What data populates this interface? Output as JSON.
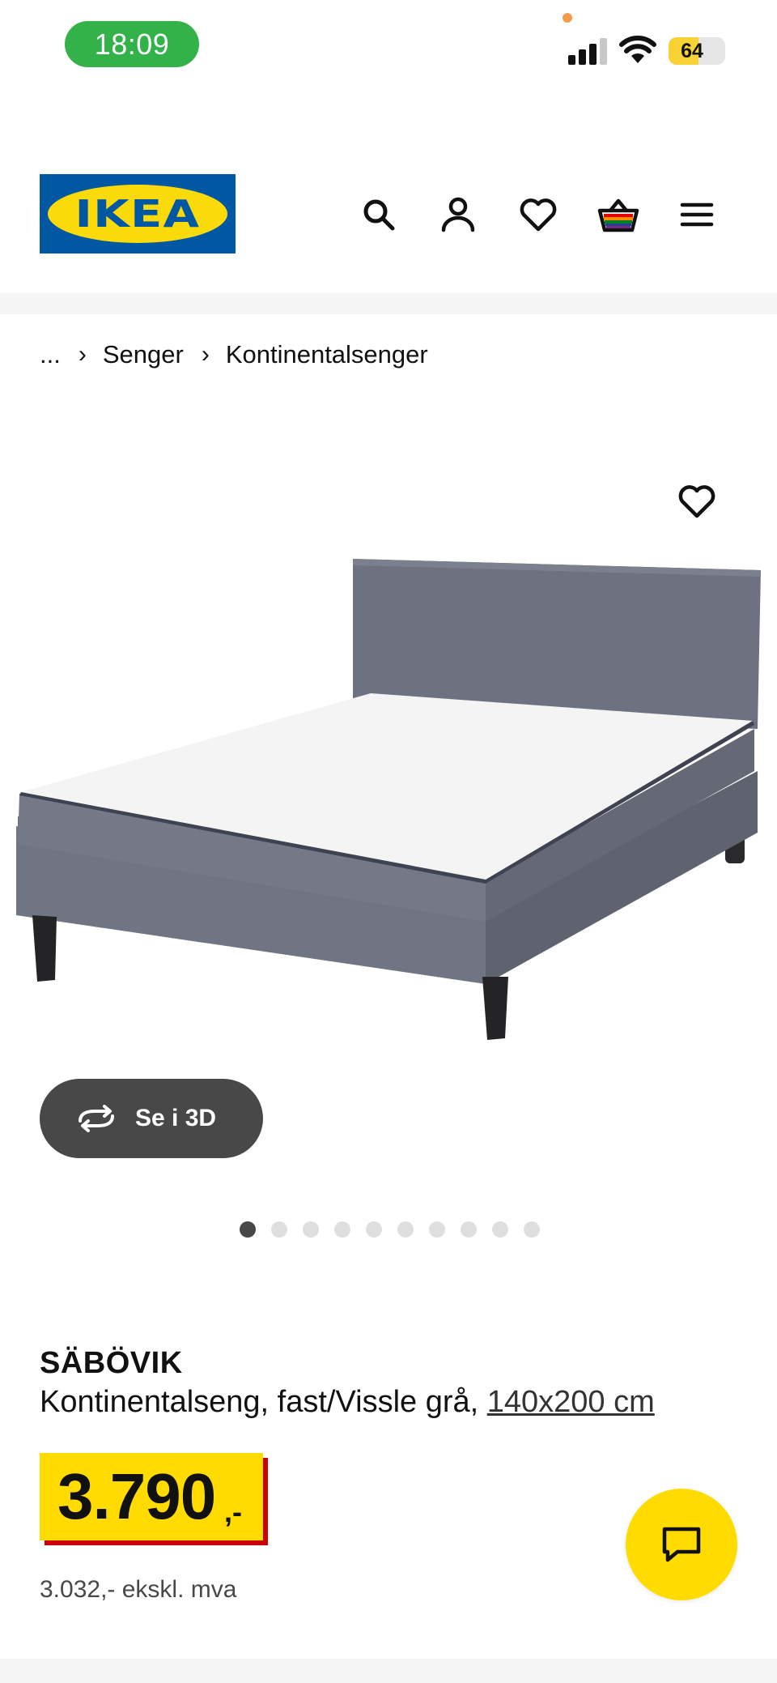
{
  "status_bar": {
    "time": "18:09",
    "battery": "64",
    "battery_level": 0.64
  },
  "header": {
    "logo_text": "IKEA",
    "icons": [
      "search-icon",
      "account-icon",
      "favourites-icon",
      "basket-icon",
      "menu-icon"
    ]
  },
  "breadcrumb": {
    "ellipsis": "...",
    "items": [
      "Senger",
      "Kontinentalsenger"
    ]
  },
  "gallery": {
    "view_3d_label": "Se i 3D",
    "image_count": 10,
    "active_index": 0
  },
  "product": {
    "name": "SÄBÖVIK",
    "description": "Kontinentalseng, fast/Vissle grå,",
    "size": "140x200 cm",
    "price": "3.790",
    "price_suffix": ",-",
    "price_ex_vat": "3.032,- ekskl. mva"
  },
  "colors": {
    "brand_blue": "#0058a3",
    "brand_yellow": "#ffdb00",
    "price_red": "#cc0008",
    "time_pill_green": "#34b24a"
  }
}
